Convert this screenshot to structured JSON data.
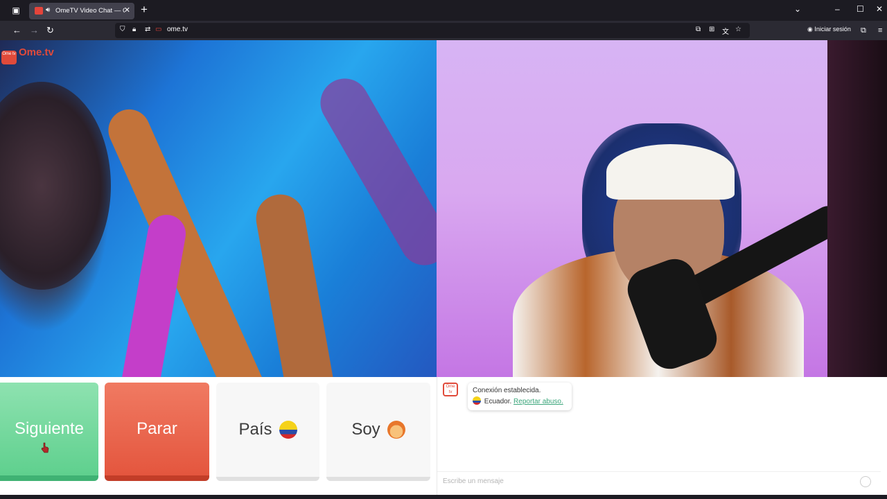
{
  "browser": {
    "tab_title": "OmeTV Video Chat — Ome",
    "url": "ome.tv",
    "signin_label": "Iniciar sesión",
    "new_tab_glyph": "+",
    "tab_close_glyph": "✕"
  },
  "logo": {
    "badge": "Ome tv",
    "text": "Ome.tv"
  },
  "controls": {
    "next_label": "Siguiente",
    "stop_label": "Parar",
    "country_label": "País",
    "gender_label": "Soy"
  },
  "chat": {
    "logo_badge": "Ome tv",
    "status": "Conexión establecida.",
    "country": "Ecuador.",
    "report_label": "Reportar abuso.",
    "placeholder": "Escribe un mensaje"
  },
  "colors": {
    "next": "#5fd08e",
    "stop": "#e4563e",
    "brand": "#e04a3a",
    "link": "#3aa57a"
  }
}
